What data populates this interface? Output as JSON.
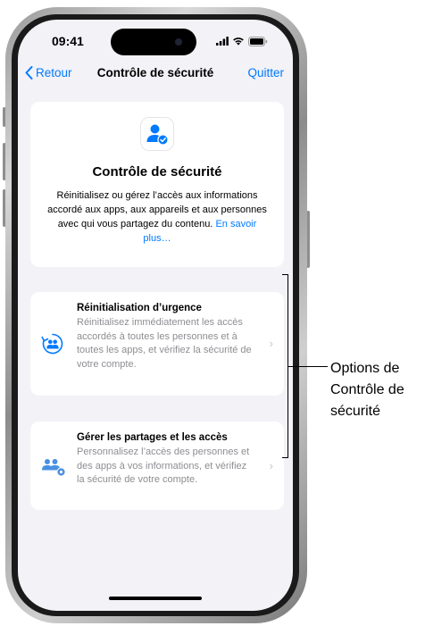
{
  "status_bar": {
    "time": "09:41"
  },
  "nav": {
    "back_label": "Retour",
    "title": "Contrôle de sécurité",
    "quit_label": "Quitter"
  },
  "hero": {
    "title": "Contrôle de sécurité",
    "description": "Réinitialisez ou gérez l’accès aux informations accordé aux apps, aux appareils et aux personnes avec qui vous partagez du contenu.",
    "link": "En savoir plus…"
  },
  "options": [
    {
      "title": "Réinitialisation d’urgence",
      "description": "Réinitialisez immédiatement les accès accordés à toutes les personnes et à toutes les apps, et vérifiez la sécurité de votre compte.",
      "icon": "emergency-reset-icon"
    },
    {
      "title": "Gérer les partages et les accès",
      "description": "Personnalisez l’accès des personnes et des apps à vos informations, et vérifiez la sécurité de votre compte.",
      "icon": "manage-sharing-icon"
    }
  ],
  "callout": {
    "text": "Options de Contrôle de sécurité"
  },
  "colors": {
    "accent": "#007aff",
    "background": "#f2f2f7",
    "secondary_text": "#8e8e93"
  }
}
